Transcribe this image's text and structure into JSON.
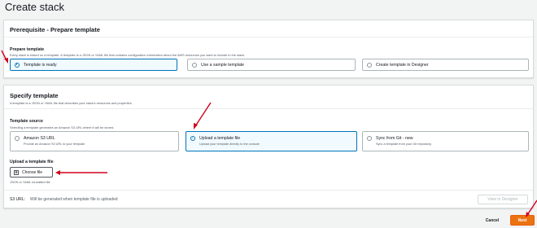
{
  "page": {
    "title": "Create stack"
  },
  "prerequisite": {
    "heading": "Prerequisite - Prepare template",
    "field_label": "Prepare template",
    "field_desc": "Every stack is based on a template. A template is a JSON or YAML file that contains configuration information about the AWS resources you want to include in the stack.",
    "options": [
      {
        "label": "Template is ready",
        "selected": true
      },
      {
        "label": "Use a sample template",
        "selected": false
      },
      {
        "label": "Create template in Designer",
        "selected": false
      }
    ]
  },
  "specify": {
    "heading": "Specify template",
    "heading_desc": "A template is a JSON or YAML file that describes your stack's resources and properties.",
    "source_label": "Template source",
    "source_desc": "Selecting a template generates an Amazon S3 URL where it will be stored.",
    "sources": [
      {
        "label": "Amazon S3 URL",
        "sub": "Provide an Amazon S3 URL to your template",
        "selected": false
      },
      {
        "label": "Upload a template file",
        "sub": "Upload your template directly to the console",
        "selected": true
      },
      {
        "label": "Sync from Git - new",
        "sub": "Sync a template from your Git repository.",
        "selected": false
      }
    ],
    "upload_label": "Upload a template file",
    "choose_file": "Choose file",
    "file_hint": "JSON or YAML formatted file",
    "s3_url_label": "S3 URL:",
    "s3_url_value": "Will be generated when template file is uploaded",
    "view_designer": "View in Designer"
  },
  "footer": {
    "cancel": "Cancel",
    "next": "Next"
  },
  "colors": {
    "accent": "#0073bb",
    "primary_button": "#ec7211",
    "annotation_arrow": "#d0021b"
  }
}
